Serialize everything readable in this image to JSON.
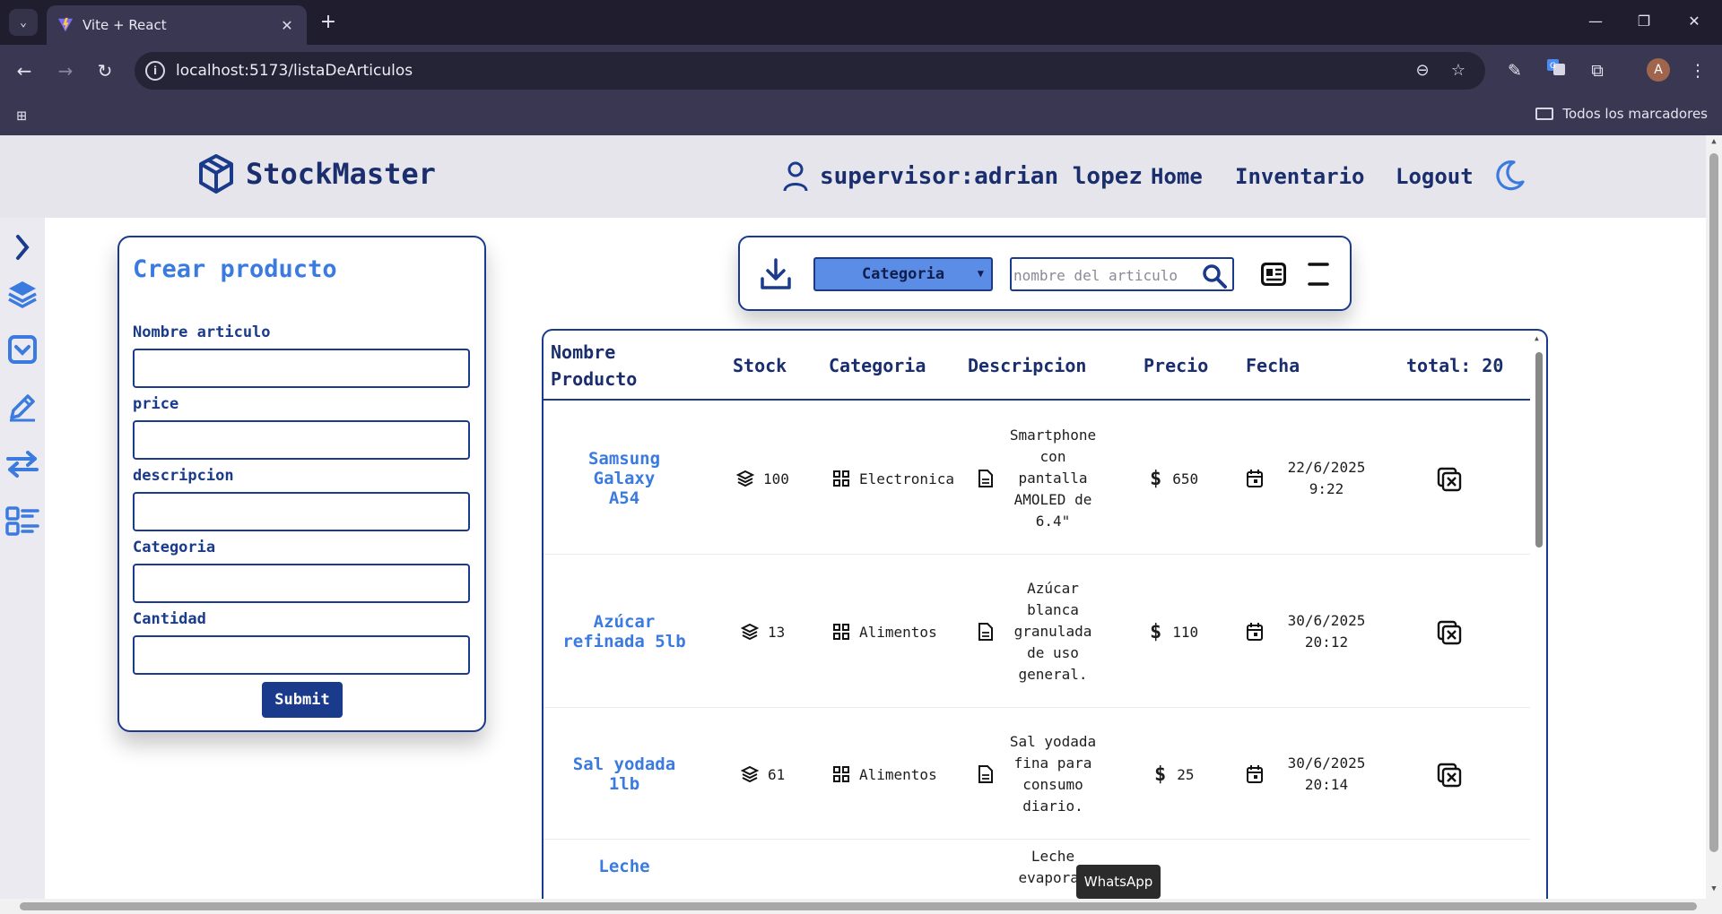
{
  "browser": {
    "tab_title": "Vite + React",
    "url": "localhost:5173/listaDeArticulos",
    "bookmarks_folder": "Todos los marcadores",
    "profile_initial": "A"
  },
  "header": {
    "brand": "StockMaster",
    "user": "supervisor:adrian lopez",
    "nav": {
      "home": "Home",
      "inventory": "Inventario",
      "logout": "Logout"
    }
  },
  "form": {
    "title": "Crear producto",
    "fields": [
      {
        "label": "Nombre articulo",
        "value": ""
      },
      {
        "label": "price",
        "value": ""
      },
      {
        "label": "descripcion",
        "value": ""
      },
      {
        "label": "Categoria",
        "value": ""
      },
      {
        "label": "Cantidad",
        "value": ""
      }
    ],
    "submit": "Submit"
  },
  "filters": {
    "category_selected": "Categoria",
    "search_placeholder": "nombre del articulo"
  },
  "table": {
    "headers": {
      "name_line1": "Nombre",
      "name_line2": "Producto",
      "stock": "Stock",
      "category": "Categoria",
      "description": "Descripcion",
      "price": "Precio",
      "date": "Fecha",
      "total": "total: 20"
    },
    "rows": [
      {
        "name_line1": "Samsung Galaxy",
        "name_line2": "A54",
        "stock": "100",
        "category": "Electronica",
        "desc_lines": [
          "Smartphone",
          "con",
          "pantalla",
          "AMOLED de",
          "6.4\""
        ],
        "price": "650",
        "date_line1": "22/6/2025",
        "date_line2": "9:22"
      },
      {
        "name_line1": "Azúcar",
        "name_line2": "refinada 5lb",
        "stock": "13",
        "category": "Alimentos",
        "desc_lines": [
          "Azúcar",
          "blanca",
          "granulada",
          "de uso",
          "general."
        ],
        "price": "110",
        "date_line1": "30/6/2025",
        "date_line2": "20:12"
      },
      {
        "name_line1": "Sal yodada 1lb",
        "name_line2": "",
        "stock": "61",
        "category": "Alimentos",
        "desc_lines": [
          "Sal yodada",
          "fina para",
          "consumo",
          "diario."
        ],
        "price": "25",
        "date_line1": "30/6/2025",
        "date_line2": "20:14"
      },
      {
        "name_line1": "Leche",
        "name_line2": "",
        "stock": "",
        "category": "",
        "desc_lines": [
          "Leche",
          "evaporad"
        ],
        "price": "",
        "date_line1": "",
        "date_line2": ""
      }
    ]
  },
  "tooltip": "WhatsApp",
  "colors": {
    "primary": "#1a3a8c",
    "accent": "#3b7be0",
    "header_bg": "#e6e5eb"
  }
}
